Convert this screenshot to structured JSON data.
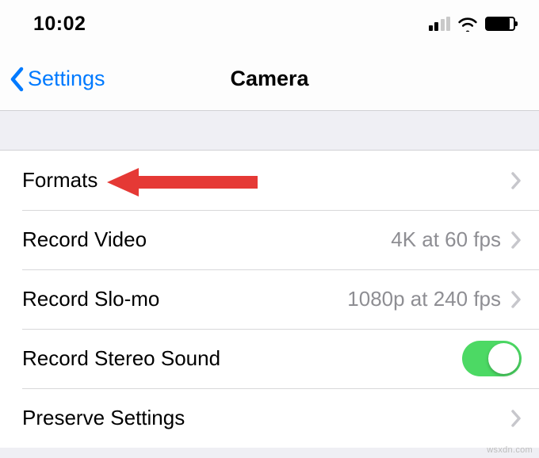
{
  "status": {
    "time": "10:02"
  },
  "nav": {
    "back_label": "Settings",
    "title": "Camera"
  },
  "rows": {
    "formats": {
      "label": "Formats"
    },
    "record_video": {
      "label": "Record Video",
      "value": "4K at 60 fps"
    },
    "record_slomo": {
      "label": "Record Slo-mo",
      "value": "1080p at 240 fps"
    },
    "stereo_sound": {
      "label": "Record Stereo Sound",
      "toggle": true
    },
    "preserve": {
      "label": "Preserve Settings"
    }
  },
  "watermark": "wsxdn.com"
}
